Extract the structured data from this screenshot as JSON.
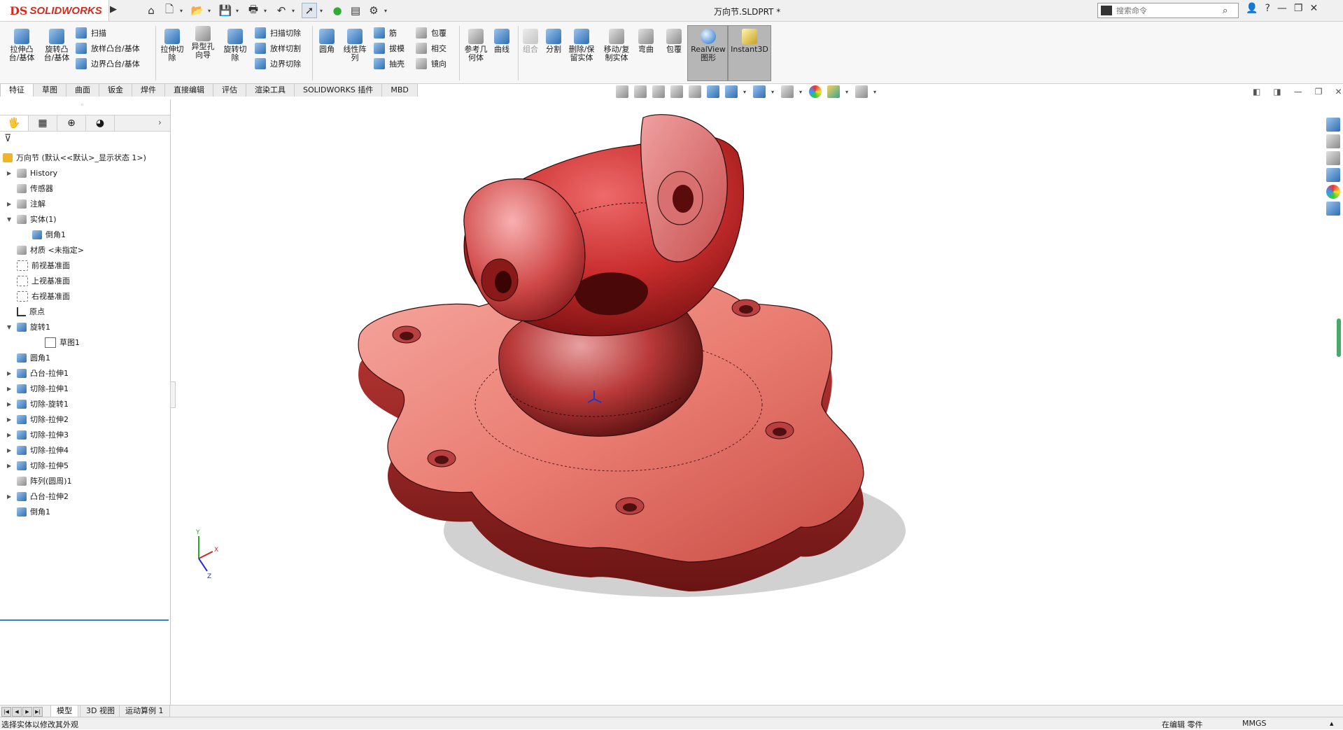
{
  "app": {
    "brand_ds": "DS",
    "brand_name": "SOLIDWORKS",
    "doc_title": "万向节.SLDPRT *"
  },
  "search": {
    "placeholder": "搜索命令"
  },
  "ribbon": {
    "buttons": {
      "extrude_boss": "拉伸凸台/基体",
      "revolve_boss": "旋转凸台/基体",
      "sweep": "扫描",
      "loft_boss": "放样凸台/基体",
      "boundary_boss": "边界凸台/基体",
      "extrude_cut": "拉伸切除",
      "hole_wizard": "异型孔向导",
      "revolve_cut": "旋转切除",
      "sweep_cut": "扫描切除",
      "loft_cut": "放样切割",
      "boundary_cut": "边界切除",
      "fillet": "圆角",
      "linear_pattern": "线性阵列",
      "rib": "筋",
      "draft": "拔模",
      "shell": "抽壳",
      "wrap": "包覆",
      "intersect": "相交",
      "mirror": "镜向",
      "ref_geometry": "参考几何体",
      "curves": "曲线",
      "combine": "组合",
      "split": "分割",
      "delete_keep_body": "删除/保留实体",
      "move_copy_body": "移动/复制实体",
      "flex": "弯曲",
      "wrap2": "包覆",
      "realview": "RealView图形",
      "instant3d": "Instant3D"
    }
  },
  "tabs": [
    "特征",
    "草图",
    "曲面",
    "钣金",
    "焊件",
    "直接编辑",
    "评估",
    "渲染工具",
    "SOLIDWORKS 插件",
    "MBD"
  ],
  "tree": {
    "root": "万向节 (默认<<默认>_显示状态 1>)",
    "items": {
      "history": "History",
      "sensors": "传感器",
      "annotations": "注解",
      "solid_bodies": "实体(1)",
      "chamfer_body": "倒角1",
      "material": "材质 <未指定>",
      "front_plane": "前视基准面",
      "top_plane": "上视基准面",
      "right_plane": "右视基准面",
      "origin": "原点",
      "revolve1": "旋转1",
      "sketch1": "草图1",
      "fillet1": "圆角1",
      "boss_extrude1": "凸台-拉伸1",
      "cut_extrude1": "切除-拉伸1",
      "cut_revolve1": "切除-旋转1",
      "cut_extrude2": "切除-拉伸2",
      "cut_extrude3": "切除-拉伸3",
      "cut_extrude4": "切除-拉伸4",
      "cut_extrude5": "切除-拉伸5",
      "circular_pattern1": "阵列(圆周)1",
      "boss_extrude2": "凸台-拉伸2",
      "chamfer1": "倒角1"
    }
  },
  "bottom_tabs": [
    "模型",
    "3D 视图",
    "运动算例 1"
  ],
  "status": {
    "left": "选择实体以修改其外观",
    "mode": "在编辑 零件",
    "units": "MMGS"
  },
  "colors": {
    "part_red": "#e04848",
    "accent_blue": "#3a7ec8",
    "brand_red": "#d52b1e"
  }
}
